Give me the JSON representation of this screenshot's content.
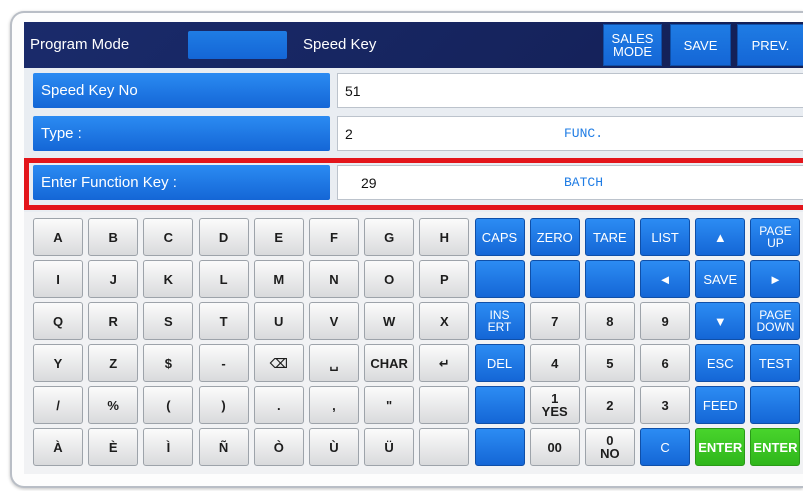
{
  "colors": {
    "navy": "#1a2b6b",
    "blue": "#1f7ce4",
    "green": "#48d42c",
    "highlight": "#e3151b"
  },
  "header": {
    "title": "Program Mode",
    "screen": "Speed Key",
    "sales_mode": [
      "SALES",
      "MODE"
    ],
    "save": "SAVE",
    "prev": "PREV."
  },
  "fields": [
    {
      "label": "Speed Key No",
      "value": "51",
      "desc": ""
    },
    {
      "label": "Type :",
      "value": "2",
      "desc": "FUNC."
    },
    {
      "label": "Enter Function Key :",
      "value": "29",
      "desc": "BATCH",
      "highlighted": true
    }
  ],
  "keyboard": {
    "rows": [
      [
        {
          "t": "A",
          "c": "gray"
        },
        {
          "t": "B",
          "c": "gray"
        },
        {
          "t": "C",
          "c": "gray"
        },
        {
          "t": "D",
          "c": "gray"
        },
        {
          "t": "E",
          "c": "gray"
        },
        {
          "t": "F",
          "c": "gray"
        },
        {
          "t": "G",
          "c": "gray"
        },
        {
          "t": "H",
          "c": "gray"
        },
        {
          "t": "CAPS",
          "c": "blue"
        },
        {
          "t": "ZERO",
          "c": "blue"
        },
        {
          "t": "TARE",
          "c": "blue"
        },
        {
          "t": "LIST",
          "c": "blue"
        },
        {
          "t": "▲",
          "c": "blue",
          "icon": "up-arrow-icon"
        },
        {
          "t": "PAGE",
          "t2": "UP",
          "c": "blue"
        }
      ],
      [
        {
          "t": "I",
          "c": "gray"
        },
        {
          "t": "J",
          "c": "gray"
        },
        {
          "t": "K",
          "c": "gray"
        },
        {
          "t": "L",
          "c": "gray"
        },
        {
          "t": "M",
          "c": "gray"
        },
        {
          "t": "N",
          "c": "gray"
        },
        {
          "t": "O",
          "c": "gray"
        },
        {
          "t": "P",
          "c": "gray"
        },
        {
          "t": "",
          "c": "blue"
        },
        {
          "t": "",
          "c": "blue"
        },
        {
          "t": "",
          "c": "blue"
        },
        {
          "t": "◄",
          "c": "blue",
          "icon": "left-arrow-icon"
        },
        {
          "t": "SAVE",
          "c": "blue"
        },
        {
          "t": "►",
          "c": "blue",
          "icon": "right-arrow-icon"
        }
      ],
      [
        {
          "t": "Q",
          "c": "gray"
        },
        {
          "t": "R",
          "c": "gray"
        },
        {
          "t": "S",
          "c": "gray"
        },
        {
          "t": "T",
          "c": "gray"
        },
        {
          "t": "U",
          "c": "gray"
        },
        {
          "t": "V",
          "c": "gray"
        },
        {
          "t": "W",
          "c": "gray"
        },
        {
          "t": "X",
          "c": "gray"
        },
        {
          "t": "INS",
          "t2": "ERT",
          "c": "blue"
        },
        {
          "t": "7",
          "c": "gray"
        },
        {
          "t": "8",
          "c": "gray"
        },
        {
          "t": "9",
          "c": "gray"
        },
        {
          "t": "▼",
          "c": "blue",
          "icon": "down-arrow-icon"
        },
        {
          "t": "PAGE",
          "t2": "DOWN",
          "c": "blue"
        }
      ],
      [
        {
          "t": "Y",
          "c": "gray"
        },
        {
          "t": "Z",
          "c": "gray"
        },
        {
          "t": "$",
          "c": "gray"
        },
        {
          "t": "-",
          "c": "gray"
        },
        {
          "t": "⌫",
          "c": "gray",
          "icon": "backspace-icon"
        },
        {
          "t": "␣",
          "c": "gray",
          "icon": "space-icon"
        },
        {
          "t": "CHAR",
          "c": "gray"
        },
        {
          "t": "↵",
          "c": "gray",
          "icon": "return-icon"
        },
        {
          "t": "DEL",
          "c": "blue"
        },
        {
          "t": "4",
          "c": "gray"
        },
        {
          "t": "5",
          "c": "gray"
        },
        {
          "t": "6",
          "c": "gray"
        },
        {
          "t": "ESC",
          "c": "blue"
        },
        {
          "t": "TEST",
          "c": "blue"
        }
      ],
      [
        {
          "t": "/",
          "c": "gray"
        },
        {
          "t": "%",
          "c": "gray"
        },
        {
          "t": "(",
          "c": "gray"
        },
        {
          "t": ")",
          "c": "gray"
        },
        {
          "t": ".",
          "c": "gray"
        },
        {
          "t": ",",
          "c": "gray"
        },
        {
          "t": "\"",
          "c": "gray"
        },
        {
          "t": "",
          "c": "gray"
        },
        {
          "t": "",
          "c": "blue"
        },
        {
          "t": "1",
          "t2": "YES",
          "c": "gray"
        },
        {
          "t": "2",
          "c": "gray"
        },
        {
          "t": "3",
          "c": "gray"
        },
        {
          "t": "FEED",
          "c": "blue"
        },
        {
          "t": "",
          "c": "blue"
        }
      ],
      [
        {
          "t": "À",
          "c": "gray"
        },
        {
          "t": "È",
          "c": "gray"
        },
        {
          "t": "Ì",
          "c": "gray"
        },
        {
          "t": "Ñ",
          "c": "gray"
        },
        {
          "t": "Ò",
          "c": "gray"
        },
        {
          "t": "Ù",
          "c": "gray"
        },
        {
          "t": "Ü",
          "c": "gray"
        },
        {
          "t": "",
          "c": "gray"
        },
        {
          "t": "",
          "c": "blue"
        },
        {
          "t": "00",
          "c": "gray"
        },
        {
          "t": "0",
          "t2": "NO",
          "c": "gray"
        },
        {
          "t": "C",
          "c": "blue"
        },
        {
          "t": "ENTER",
          "c": "green"
        },
        {
          "t": "ENTER",
          "c": "green"
        }
      ]
    ]
  }
}
